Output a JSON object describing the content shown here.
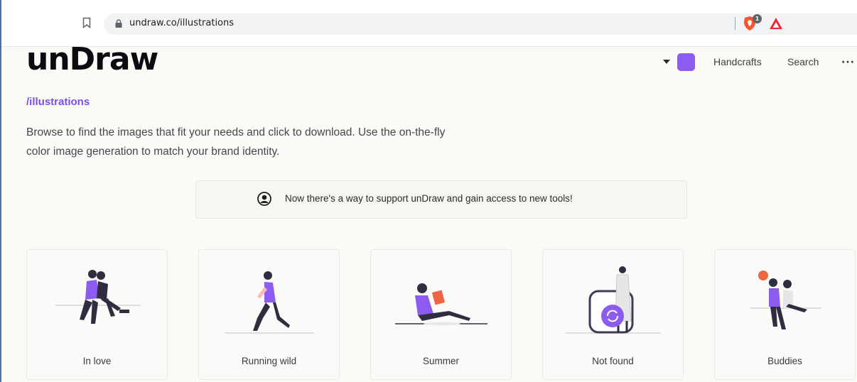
{
  "browser": {
    "url": "undraw.co/illustrations",
    "brave_badge_count": "1",
    "icons": [
      "bookmark-icon",
      "lock-icon",
      "brave-shield-icon",
      "brave-rewards-icon"
    ]
  },
  "header": {
    "logo": "unDraw",
    "nav": {
      "handcrafts": "Handcrafts",
      "search": "Search",
      "more": "···"
    },
    "accent_color": "#8c5cf0"
  },
  "hero": {
    "subtitle": "/illustrations",
    "intro": "Browse to find the images that fit your needs and click to download. Use the on-the-fly color image generation to match your brand identity."
  },
  "support_banner": {
    "text": "Now there's a way to support unDraw and gain access to new tools!"
  },
  "illustrations": [
    {
      "label": "In love"
    },
    {
      "label": "Running wild"
    },
    {
      "label": "Summer"
    },
    {
      "label": "Not found"
    },
    {
      "label": "Buddies"
    }
  ]
}
